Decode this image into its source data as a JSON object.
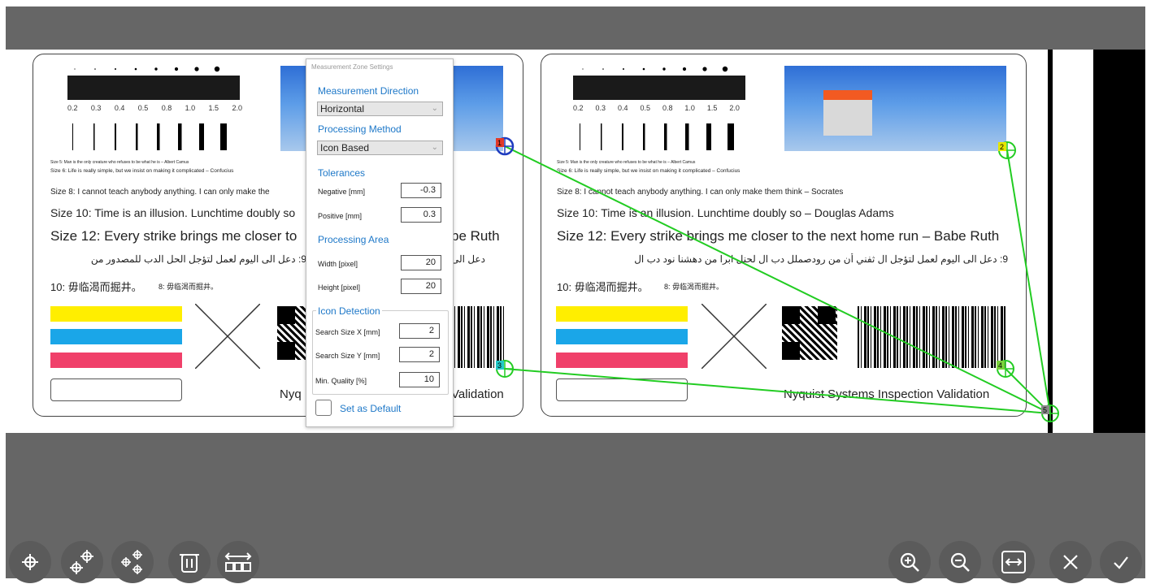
{
  "image": {
    "left_card": {
      "scale_labels": [
        "0.2",
        "0.3",
        "0.4",
        "0.5",
        "0.8",
        "1.0",
        "1.5",
        "2.0"
      ],
      "size5": "Size 5: Man is the only creature who refuses to be what he is – Albert Camus",
      "size6": "Size 6: Life is really simple, but we insist on making it complicated – Confucius",
      "size8": "Size 8: I cannot teach anybody anything. I can only make the",
      "size10": "Size 10: Time is an illusion. Lunchtime doubly so",
      "size12": "Size 12: Every strike brings me closer to",
      "size12_tail": "be Ruth",
      "arabic": "9: دعل الى اليوم لعمل لتؤجل الحل الدب للمصدور من",
      "arabic_tail": "دعل الى",
      "cjk": "10: 毋临渴而掘井。",
      "cjk_small": "8: 毋临渴而掘井。",
      "footer_left": "Nyq",
      "footer_right": "Validation"
    },
    "right_card": {
      "scale_labels": [
        "0.2",
        "0.3",
        "0.4",
        "0.5",
        "0.8",
        "1.0",
        "1.5",
        "2.0"
      ],
      "size5": "Size 5: Man is the only creature who refuses to be what he is – Albert Camus",
      "size6": "Size 6: Life is really simple, but we insist on making it complicated – Confucius",
      "size8": "Size 8: I cannot teach anybody anything. I can only make them think – Socrates",
      "size10": "Size 10: Time is an illusion. Lunchtime doubly so – Douglas Adams",
      "size12": "Size 12: Every strike brings me closer to the next home run – Babe Ruth",
      "arabic": "9: دعل الى اليوم لعمل لتؤجل ال ثفني أن من رودصملل دب ال لحنل ابرا من دهشنا نود دب ال",
      "cjk": "10: 毋临渴而掘井。",
      "cjk_small": "8: 毋临渴而掘井。",
      "footer": "Nyquist Systems Inspection Validation"
    },
    "markers": [
      "1",
      "2",
      "3",
      "4",
      "5"
    ],
    "colors": {
      "yellow": "#ffee00",
      "cyan": "#1aa6e8",
      "magenta": "#f0406a",
      "marker_line": "#22cc22",
      "marker_blue": "#1f3cbf"
    }
  },
  "panel": {
    "title": "Measurement Zone Settings",
    "measurement_direction_label": "Measurement Direction",
    "measurement_direction_value": "Horizontal",
    "processing_method_label": "Processing Method",
    "processing_method_value": "Icon Based",
    "tolerances_label": "Tolerances",
    "negative_label": "Negative [mm]",
    "negative_value": "-0.3",
    "positive_label": "Positive [mm]",
    "positive_value": "0.3",
    "processing_area_label": "Processing Area",
    "width_label": "Width [pixel]",
    "width_value": "20",
    "height_label": "Height [pixel]",
    "height_value": "20",
    "icon_detection_label": "Icon Detection",
    "search_x_label": "Search Size X [mm]",
    "search_x_value": "2",
    "search_y_label": "Search Size Y [mm]",
    "search_y_value": "2",
    "min_quality_label": "Min. Quality [%]",
    "min_quality_value": "10",
    "set_default_label": "Set as Default"
  },
  "toolbar": {
    "left_buttons": [
      "add-point",
      "add-two-points",
      "add-multi-points",
      "delete",
      "distribute"
    ],
    "right_buttons": [
      "zoom-in",
      "zoom-out",
      "fit-width",
      "cancel",
      "confirm"
    ]
  }
}
